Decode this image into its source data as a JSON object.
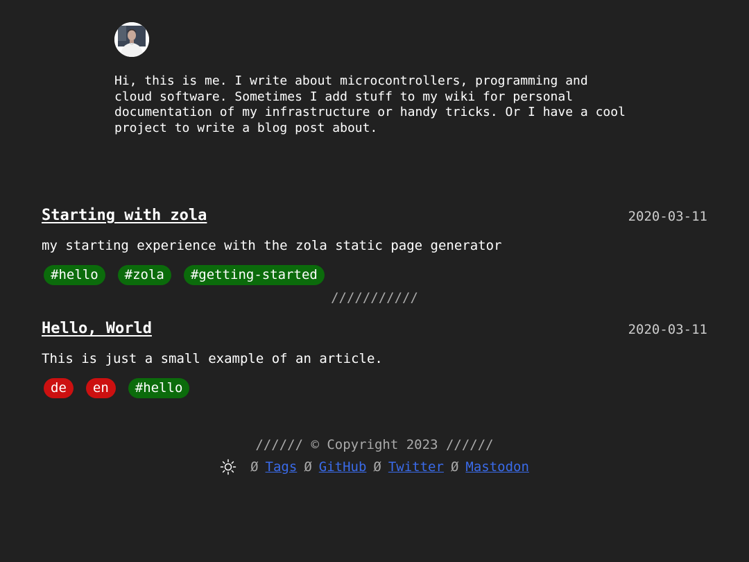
{
  "profile": {
    "avatar_icon": "profile-photo",
    "bio": "Hi, this is me. I write about microcontrollers, programming and cloud software. Sometimes I add stuff to my wiki for personal documentation of my infrastructure or handy tricks. Or I have a cool project to write a blog post about."
  },
  "posts": [
    {
      "title": "Starting with zola",
      "date": "2020-03-11",
      "description": "my starting experience with the zola static page generator",
      "tags": [
        {
          "label": "#hello",
          "color": "#0b6b0b"
        },
        {
          "label": "#zola",
          "color": "#0b6b0b"
        },
        {
          "label": "#getting-started",
          "color": "#0b6b0b"
        }
      ]
    },
    {
      "title": "Hello, World",
      "date": "2020-03-11",
      "description": "This is just a small example of an article.",
      "tags": [
        {
          "label": "de",
          "color": "#cc1010"
        },
        {
          "label": "en",
          "color": "#cc1010"
        },
        {
          "label": "#hello",
          "color": "#0b6b0b"
        }
      ]
    }
  ],
  "divider": "///////////",
  "footer": {
    "copyright": "////// © Copyright 2023 //////",
    "theme_toggle_icon": "sun-icon",
    "separator": "Ø",
    "links": [
      {
        "label": "Tags"
      },
      {
        "label": "GitHub"
      },
      {
        "label": "Twitter"
      },
      {
        "label": "Mastodon"
      }
    ]
  },
  "colors": {
    "background": "#212121",
    "text": "#ffffff",
    "muted": "#aaaaaa",
    "link": "#3a6bea",
    "tag_green": "#0b6b0b",
    "tag_red": "#cc1010"
  }
}
